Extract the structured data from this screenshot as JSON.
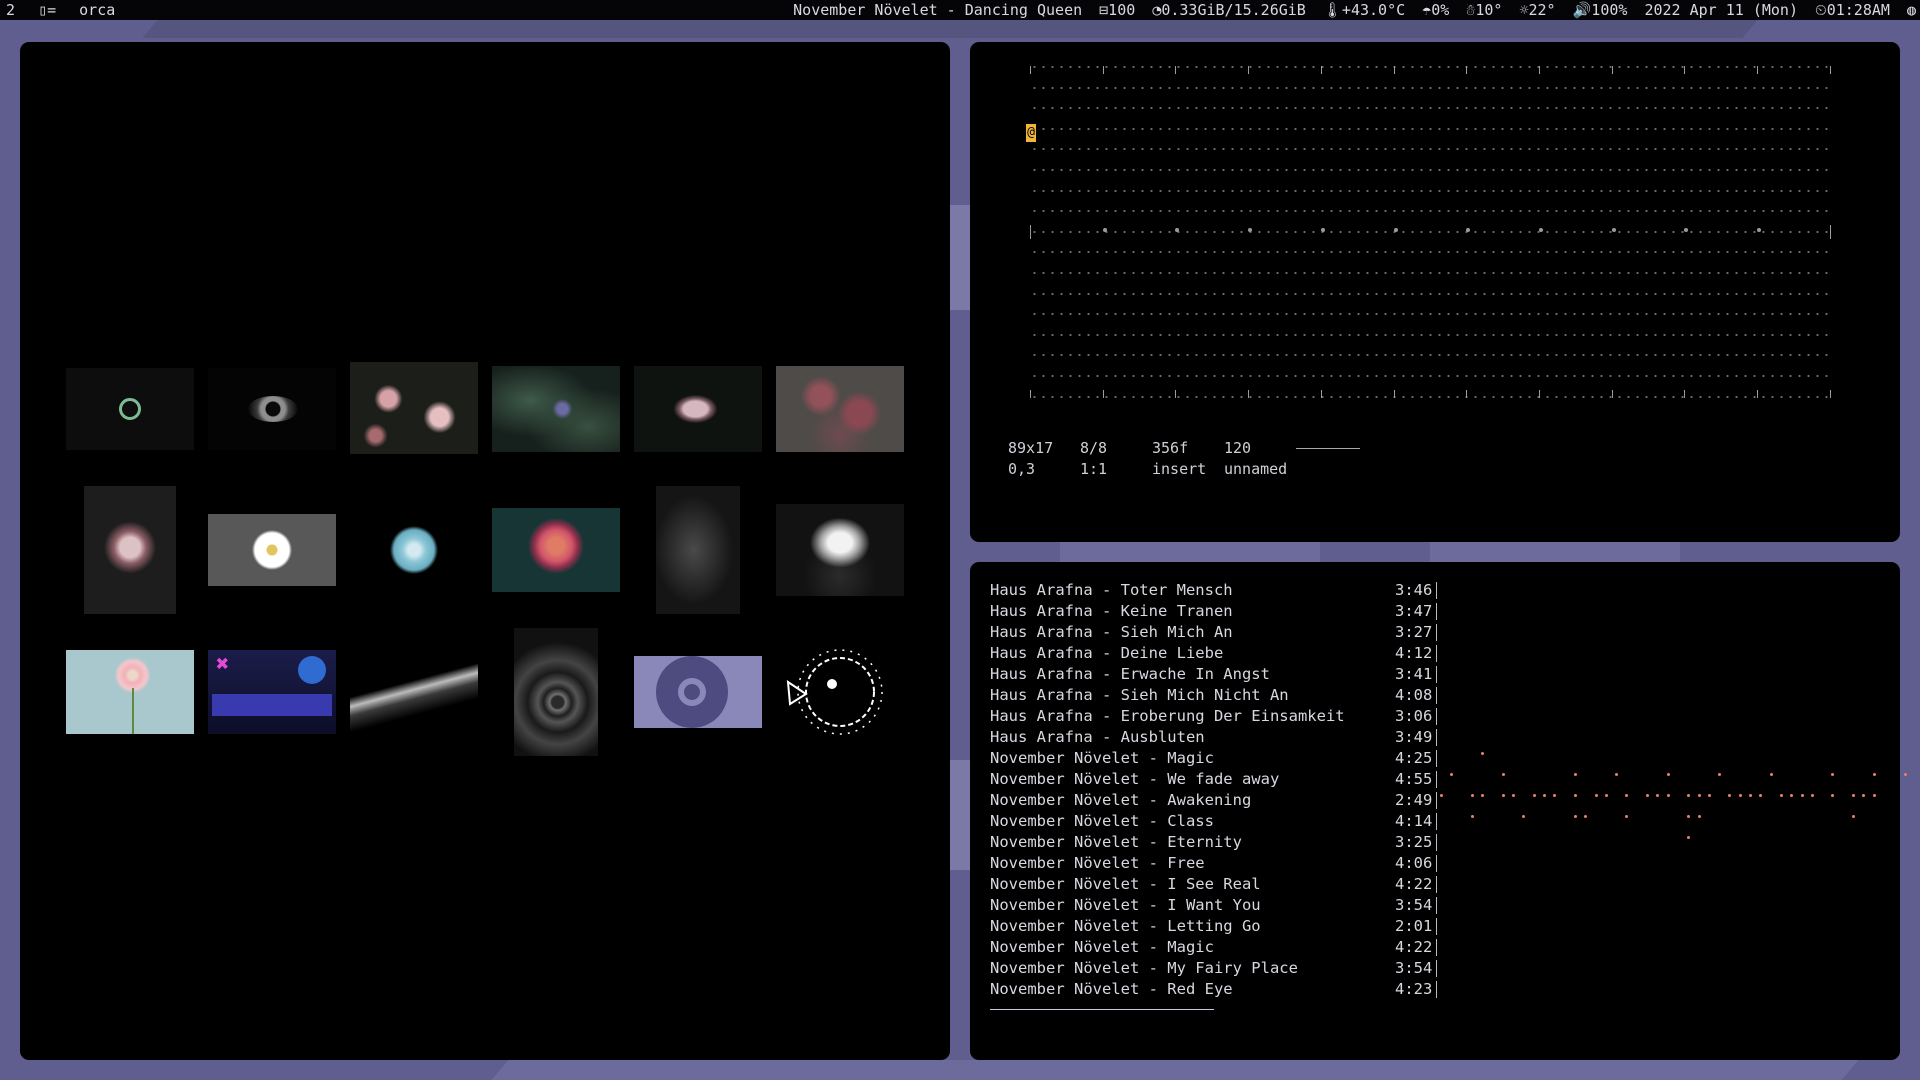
{
  "topbar": {
    "workspace": "2",
    "layout_icon": "▯=",
    "window_title": "orca",
    "now_playing": "November Növelet - Dancing Queen",
    "volume_level": "⊟100",
    "memory": "◔0.33GiB/15.26GiB",
    "temperature": "🌡+43.0°C",
    "precipitation": "☂0%",
    "temp_low": "☃10°",
    "temp_high": "☼22°",
    "speaker": "🔊100%",
    "date": "2022 Apr 11 (Mon)",
    "time": "⏲01:28AM",
    "tray_icon": "◍"
  },
  "gallery": {
    "thumbnails": [
      {
        "name": "thumb-ring-logo"
      },
      {
        "name": "thumb-eye"
      },
      {
        "name": "thumb-pink-blossoms"
      },
      {
        "name": "thumb-dark-leaves"
      },
      {
        "name": "thumb-bud"
      },
      {
        "name": "thumb-berries"
      },
      {
        "name": "thumb-wilted-rose"
      },
      {
        "name": "thumb-white-daisy"
      },
      {
        "name": "thumb-blue-rose"
      },
      {
        "name": "thumb-dahlia"
      },
      {
        "name": "thumb-fern"
      },
      {
        "name": "thumb-white-lotus"
      },
      {
        "name": "thumb-pink-gerbera"
      },
      {
        "name": "thumb-anime-room"
      },
      {
        "name": "thumb-dark-waves"
      },
      {
        "name": "thumb-spiral-shell"
      },
      {
        "name": "thumb-ring-lavender"
      },
      {
        "name": "thumb-pufferfish"
      }
    ]
  },
  "orca": {
    "cursor_char": "@",
    "status": {
      "grid_size": "89x17",
      "ratio": "8/8",
      "frame": "356f",
      "bpm": "120",
      "position": "0,3",
      "scale": "1:1",
      "mode": "insert",
      "file": "unnamed"
    }
  },
  "player": {
    "tracks": [
      {
        "title": "Haus Arafna - Toter Mensch",
        "duration": "3:46"
      },
      {
        "title": "Haus Arafna - Keine Tranen",
        "duration": "3:47"
      },
      {
        "title": "Haus Arafna - Sieh Mich An",
        "duration": "3:27"
      },
      {
        "title": "Haus Arafna - Deine Liebe",
        "duration": "4:12"
      },
      {
        "title": "Haus Arafna - Erwache In Angst",
        "duration": "3:41"
      },
      {
        "title": "Haus Arafna - Sieh Mich Nicht An",
        "duration": "4:08"
      },
      {
        "title": "Haus Arafna - Eroberung Der Einsamkeit",
        "duration": "3:06"
      },
      {
        "title": "Haus Arafna - Ausbluten",
        "duration": "3:49"
      },
      {
        "title": "November Növelet - Magic",
        "duration": "4:25"
      },
      {
        "title": "November Növelet - We fade away",
        "duration": "4:55"
      },
      {
        "title": "November Növelet - Awakening",
        "duration": "2:49"
      },
      {
        "title": "November Növelet - Class",
        "duration": "4:14"
      },
      {
        "title": "November Növelet - Eternity",
        "duration": "3:25"
      },
      {
        "title": "November Növelet - Free",
        "duration": "4:06"
      },
      {
        "title": "November Növelet - I See Real",
        "duration": "4:22"
      },
      {
        "title": "November Növelet - I Want You",
        "duration": "3:54"
      },
      {
        "title": "November Növelet - Letting Go",
        "duration": "2:01"
      },
      {
        "title": "November Növelet - Magic",
        "duration": "4:22"
      },
      {
        "title": "November Növelet - My Fairy Place",
        "duration": "3:54"
      },
      {
        "title": "November Növelet - Red Eye",
        "duration": "4:23"
      }
    ],
    "progress": 0.28
  },
  "colors": {
    "desktop": "#5f5e8e",
    "cursor": "#f3b43c",
    "visualizer": "#e97f70"
  }
}
